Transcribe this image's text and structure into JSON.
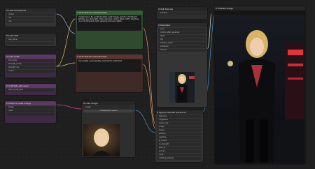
{
  "nodes": {
    "load_checkpoint": {
      "title": "Load Checkpoint",
      "rows": [
        "model",
        "clip",
        "vae"
      ]
    },
    "load_vae": {
      "title": "Load VAE",
      "rows": [
        "vae_name"
      ]
    },
    "load_lora": {
      "title": "Load LoRA",
      "rows": [
        "lora_name",
        "strength_model",
        "strength_clip",
        "model",
        "clip"
      ]
    },
    "clip_set_last_layer": {
      "title": "CLIP Set Last Layer",
      "rows": [
        "stop_at_clip_layer"
      ]
    },
    "instant_loader": {
      "title": "Instant Loader Image",
      "rows": [
        "image",
        "mask"
      ]
    },
    "clip_text_pos": {
      "title": "CLIP Text Encode (Prompt)",
      "text": "masterpiece, 8k, perfect details, best image, (photo:1.3) Margot Robbie, as a futuristic villain wearing a black latex outfit, standing in a city street at night, glowing red neon lights"
    },
    "clip_text_neg": {
      "title": "CLIP Text Encode (Prompt)",
      "text": "low quality, worst quality, bad hands, deformed"
    },
    "load_image": {
      "title": "Load Image",
      "rows": [
        "image",
        "choose file to upload"
      ]
    },
    "vae_decode": {
      "title": "VAE Decode",
      "rows": [
        "samples",
        "vae"
      ]
    },
    "ksampler": {
      "title": "KSampler",
      "rows": [
        "seed",
        "control_after_generate",
        "steps",
        "cfg",
        "sampler_name",
        "scheduler",
        "denoise"
      ]
    },
    "instantid_apply": {
      "title": "Apply InstantID Advanced",
      "rows": [
        "instantid",
        "insightface",
        "control_net",
        "image",
        "model",
        "positive",
        "negative",
        "ip_weight",
        "cn_strength",
        "start_at",
        "end_at",
        "noise",
        "combine_embeds"
      ]
    },
    "preview": {
      "title": "Preview Image"
    },
    "save_image": {
      "title": "Save Image",
      "rows": [
        "images",
        "filename_prefix"
      ]
    }
  },
  "buttons": {
    "upload": "choose file to upload"
  },
  "colors": {
    "purple": "#5a3a62",
    "green": "#365e36",
    "brown": "#5a3631",
    "wire_blue": "#3a9ad9",
    "wire_pink": "#d04a9a",
    "wire_white": "#d8d8d8"
  }
}
